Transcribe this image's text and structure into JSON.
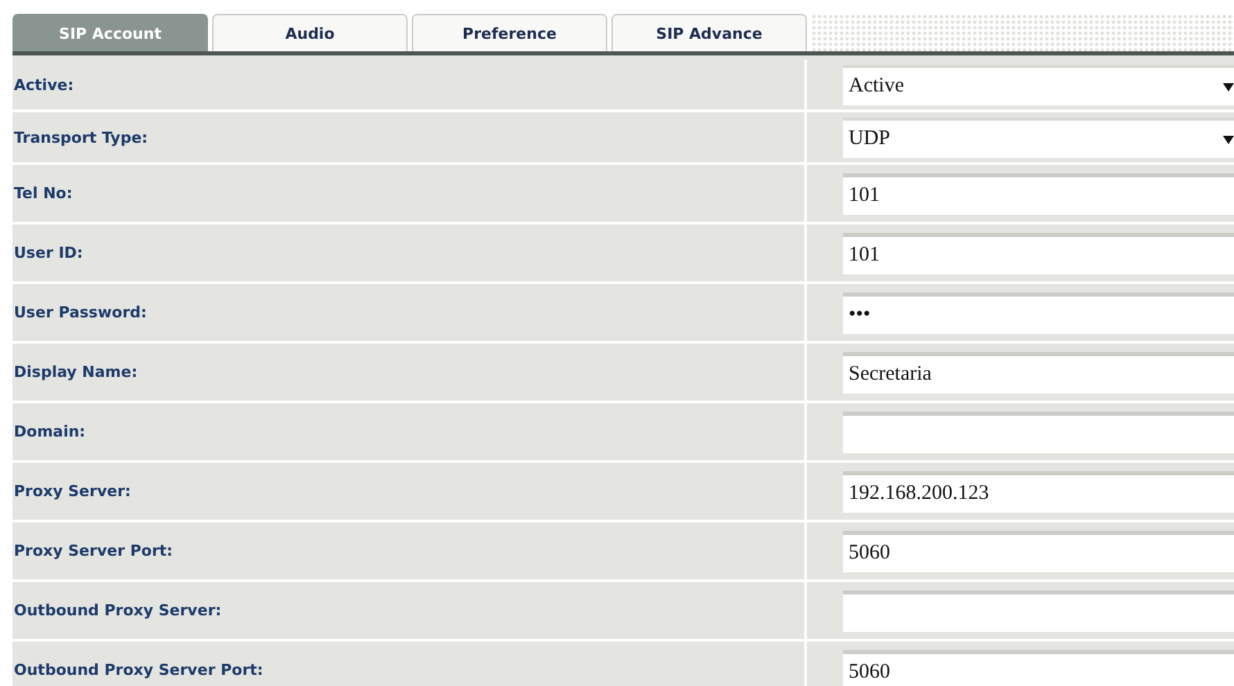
{
  "tabs": [
    {
      "label": "SIP Account",
      "selected": true
    },
    {
      "label": "Audio",
      "selected": false
    },
    {
      "label": "Preference",
      "selected": false
    },
    {
      "label": "SIP Advance",
      "selected": false
    }
  ],
  "fields": [
    {
      "label": "Active:",
      "kind": "select",
      "value": "Active"
    },
    {
      "label": "Transport Type:",
      "kind": "select",
      "value": "UDP"
    },
    {
      "label": "Tel No:",
      "kind": "text",
      "value": "101"
    },
    {
      "label": "User ID:",
      "kind": "text",
      "value": "101"
    },
    {
      "label": "User Password:",
      "kind": "text",
      "value": "•••"
    },
    {
      "label": "Display Name:",
      "kind": "text",
      "value": "Secretaria"
    },
    {
      "label": "Domain:",
      "kind": "text"
    },
    {
      "label": "Proxy Server:",
      "kind": "text",
      "value": "192.168.200.123"
    },
    {
      "label": "Proxy Server Port:",
      "kind": "text",
      "value": "5060"
    },
    {
      "label": "Outbound Proxy Server:",
      "kind": "text"
    },
    {
      "label": "Outbound Proxy Server Port:",
      "kind": "text",
      "value": "5060"
    }
  ]
}
